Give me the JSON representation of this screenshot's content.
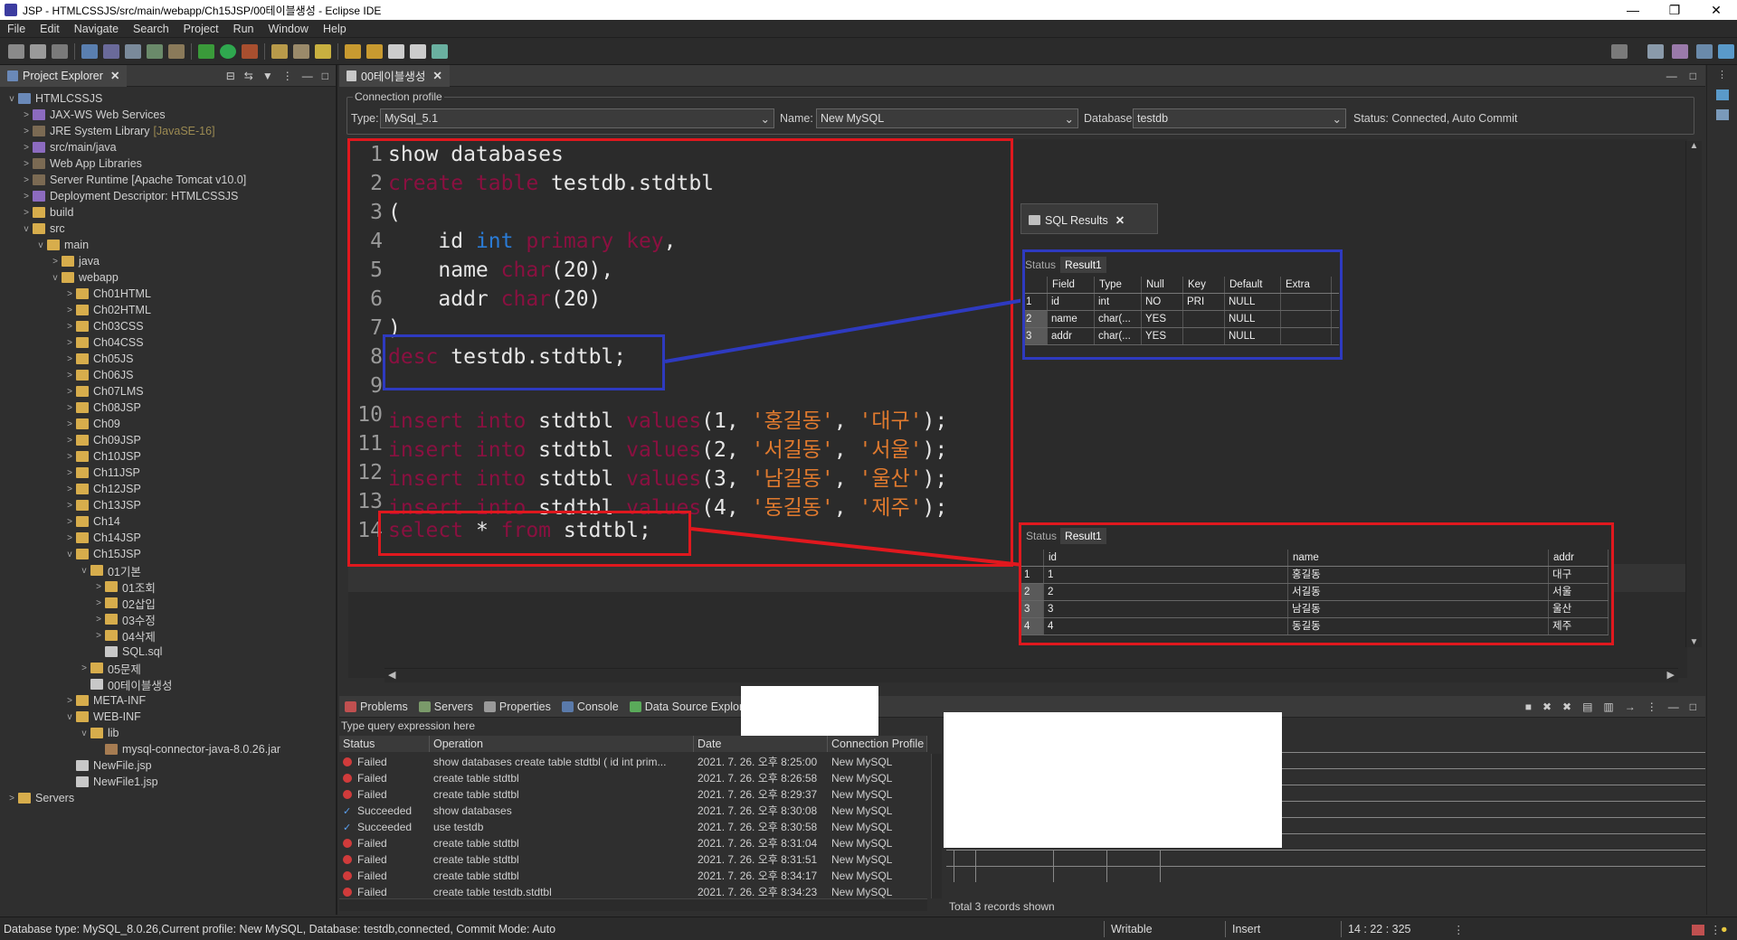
{
  "window": {
    "title": "JSP - HTMLCSSJS/src/main/webapp/Ch15JSP/00테이블생성 - Eclipse IDE",
    "min": "—",
    "max": "❐",
    "close": "✕"
  },
  "menu": [
    "File",
    "Edit",
    "Navigate",
    "Search",
    "Project",
    "Run",
    "Window",
    "Help"
  ],
  "explorer": {
    "tab_label": "Project Explorer",
    "items": [
      {
        "label": "HTMLCSSJS",
        "depth": 0,
        "twisty": "v",
        "icon": "project-icon"
      },
      {
        "label": "JAX-WS Web Services",
        "depth": 1,
        "twisty": ">",
        "icon": "service-icon"
      },
      {
        "label": "JRE System Library",
        "deco": "[JavaSE-16]",
        "depth": 1,
        "twisty": ">",
        "icon": "library-icon"
      },
      {
        "label": "src/main/java",
        "depth": 1,
        "twisty": ">",
        "icon": "source-folder-icon"
      },
      {
        "label": "Web App Libraries",
        "depth": 1,
        "twisty": ">",
        "icon": "library-icon"
      },
      {
        "label": "Server Runtime [Apache Tomcat v10.0]",
        "depth": 1,
        "twisty": ">",
        "icon": "library-icon"
      },
      {
        "label": "Deployment Descriptor: HTMLCSSJS",
        "depth": 1,
        "twisty": ">",
        "icon": "descriptor-icon"
      },
      {
        "label": "build",
        "depth": 1,
        "twisty": ">",
        "icon": "folder-icon"
      },
      {
        "label": "src",
        "depth": 1,
        "twisty": "v",
        "icon": "folder-icon"
      },
      {
        "label": "main",
        "depth": 2,
        "twisty": "v",
        "icon": "folder-icon"
      },
      {
        "label": "java",
        "depth": 3,
        "twisty": ">",
        "icon": "folder-icon"
      },
      {
        "label": "webapp",
        "depth": 3,
        "twisty": "v",
        "icon": "folder-icon"
      },
      {
        "label": "Ch01HTML",
        "depth": 4,
        "twisty": ">",
        "icon": "folder-icon"
      },
      {
        "label": "Ch02HTML",
        "depth": 4,
        "twisty": ">",
        "icon": "folder-icon"
      },
      {
        "label": "Ch03CSS",
        "depth": 4,
        "twisty": ">",
        "icon": "folder-icon"
      },
      {
        "label": "Ch04CSS",
        "depth": 4,
        "twisty": ">",
        "icon": "folder-icon"
      },
      {
        "label": "Ch05JS",
        "depth": 4,
        "twisty": ">",
        "icon": "folder-icon"
      },
      {
        "label": "Ch06JS",
        "depth": 4,
        "twisty": ">",
        "icon": "folder-icon"
      },
      {
        "label": "Ch07LMS",
        "depth": 4,
        "twisty": ">",
        "icon": "folder-icon"
      },
      {
        "label": "Ch08JSP",
        "depth": 4,
        "twisty": ">",
        "icon": "folder-icon"
      },
      {
        "label": "Ch09",
        "depth": 4,
        "twisty": ">",
        "icon": "folder-icon"
      },
      {
        "label": "Ch09JSP",
        "depth": 4,
        "twisty": ">",
        "icon": "folder-icon"
      },
      {
        "label": "Ch10JSP",
        "depth": 4,
        "twisty": ">",
        "icon": "folder-icon"
      },
      {
        "label": "Ch11JSP",
        "depth": 4,
        "twisty": ">",
        "icon": "folder-icon"
      },
      {
        "label": "Ch12JSP",
        "depth": 4,
        "twisty": ">",
        "icon": "folder-icon"
      },
      {
        "label": "Ch13JSP",
        "depth": 4,
        "twisty": ">",
        "icon": "folder-icon"
      },
      {
        "label": "Ch14",
        "depth": 4,
        "twisty": ">",
        "icon": "folder-icon"
      },
      {
        "label": "Ch14JSP",
        "depth": 4,
        "twisty": ">",
        "icon": "folder-icon"
      },
      {
        "label": "Ch15JSP",
        "depth": 4,
        "twisty": "v",
        "icon": "folder-icon"
      },
      {
        "label": "01기본",
        "depth": 5,
        "twisty": "v",
        "icon": "folder-icon"
      },
      {
        "label": "01조회",
        "depth": 6,
        "twisty": ">",
        "icon": "folder-icon"
      },
      {
        "label": "02삽입",
        "depth": 6,
        "twisty": ">",
        "icon": "folder-icon"
      },
      {
        "label": "03수정",
        "depth": 6,
        "twisty": ">",
        "icon": "folder-icon"
      },
      {
        "label": "04삭제",
        "depth": 6,
        "twisty": ">",
        "icon": "folder-icon"
      },
      {
        "label": "SQL.sql",
        "depth": 6,
        "twisty": "",
        "icon": "sql-file-icon"
      },
      {
        "label": "05문제",
        "depth": 5,
        "twisty": ">",
        "icon": "folder-icon"
      },
      {
        "label": "00테이블생성",
        "depth": 5,
        "twisty": "",
        "icon": "sql-file-icon"
      },
      {
        "label": "META-INF",
        "depth": 4,
        "twisty": ">",
        "icon": "folder-icon"
      },
      {
        "label": "WEB-INF",
        "depth": 4,
        "twisty": "v",
        "icon": "folder-icon"
      },
      {
        "label": "lib",
        "depth": 5,
        "twisty": "v",
        "icon": "folder-icon"
      },
      {
        "label": "mysql-connector-java-8.0.26.jar",
        "depth": 6,
        "twisty": "",
        "icon": "jar-icon"
      },
      {
        "label": "NewFile.jsp",
        "depth": 4,
        "twisty": "",
        "icon": "jsp-file-icon"
      },
      {
        "label": "NewFile1.jsp",
        "depth": 4,
        "twisty": "",
        "icon": "jsp-file-icon"
      },
      {
        "label": "Servers",
        "depth": 0,
        "twisty": ">",
        "icon": "folder-icon"
      }
    ]
  },
  "editor": {
    "tab_label": "00테이블생성",
    "connection": {
      "legend": "Connection profile",
      "type_label": "Type:",
      "type_value": "MySql_5.1",
      "name_label": "Name:",
      "name_value": "New MySQL",
      "db_label": "Database:",
      "db_value": "testdb",
      "status": "Status: Connected, Auto Commit"
    },
    "line_numbers": [
      "1",
      "2",
      "3",
      "4",
      "5",
      "6",
      "7",
      "8",
      "9",
      "10",
      "11",
      "12",
      "13",
      "14"
    ],
    "lines": [
      [
        {
          "t": "show databases",
          "c": "plain"
        }
      ],
      [
        {
          "t": "create table ",
          "c": "kw"
        },
        {
          "t": "testdb.stdtbl",
          "c": "plain"
        }
      ],
      [
        {
          "t": "(",
          "c": "plain"
        }
      ],
      [
        {
          "t": "    id ",
          "c": "plain"
        },
        {
          "t": "int ",
          "c": "kwb"
        },
        {
          "t": "primary key",
          "c": "kw"
        },
        {
          "t": ",",
          "c": "plain"
        }
      ],
      [
        {
          "t": "    name ",
          "c": "plain"
        },
        {
          "t": "char",
          "c": "kw"
        },
        {
          "t": "(20),",
          "c": "plain"
        }
      ],
      [
        {
          "t": "    addr ",
          "c": "plain"
        },
        {
          "t": "char",
          "c": "kw"
        },
        {
          "t": "(20)",
          "c": "plain"
        }
      ],
      [
        {
          "t": ")",
          "c": "plain"
        }
      ],
      [
        {
          "t": "desc ",
          "c": "kw"
        },
        {
          "t": "testdb.stdtbl;",
          "c": "plain"
        }
      ],
      [
        {
          "t": "",
          "c": "plain"
        }
      ],
      [
        {
          "t": "insert into ",
          "c": "kw"
        },
        {
          "t": "stdtbl ",
          "c": "plain"
        },
        {
          "t": "values",
          "c": "kw"
        },
        {
          "t": "(1, ",
          "c": "plain"
        },
        {
          "t": "'홍길동'",
          "c": "str"
        },
        {
          "t": ", ",
          "c": "plain"
        },
        {
          "t": "'대구'",
          "c": "str"
        },
        {
          "t": ");",
          "c": "plain"
        }
      ],
      [
        {
          "t": "insert into ",
          "c": "kw"
        },
        {
          "t": "stdtbl ",
          "c": "plain"
        },
        {
          "t": "values",
          "c": "kw"
        },
        {
          "t": "(2, ",
          "c": "plain"
        },
        {
          "t": "'서길동'",
          "c": "str"
        },
        {
          "t": ", ",
          "c": "plain"
        },
        {
          "t": "'서울'",
          "c": "str"
        },
        {
          "t": ");",
          "c": "plain"
        }
      ],
      [
        {
          "t": "insert into ",
          "c": "kw"
        },
        {
          "t": "stdtbl ",
          "c": "plain"
        },
        {
          "t": "values",
          "c": "kw"
        },
        {
          "t": "(3, ",
          "c": "plain"
        },
        {
          "t": "'남길동'",
          "c": "str"
        },
        {
          "t": ", ",
          "c": "plain"
        },
        {
          "t": "'울산'",
          "c": "str"
        },
        {
          "t": ");",
          "c": "plain"
        }
      ],
      [
        {
          "t": "insert into ",
          "c": "kw"
        },
        {
          "t": "stdtbl ",
          "c": "plain"
        },
        {
          "t": "values",
          "c": "kw"
        },
        {
          "t": "(4, ",
          "c": "plain"
        },
        {
          "t": "'동길동'",
          "c": "str"
        },
        {
          "t": ", ",
          "c": "plain"
        },
        {
          "t": "'제주'",
          "c": "str"
        },
        {
          "t": ");",
          "c": "plain"
        }
      ],
      [
        {
          "t": "select ",
          "c": "kw"
        },
        {
          "t": "* ",
          "c": "plain"
        },
        {
          "t": "from ",
          "c": "kw"
        },
        {
          "t": "stdtbl;",
          "c": "plain"
        }
      ]
    ]
  },
  "sql_results_popup": {
    "tab_label": "SQL Results",
    "status_tab": "Status",
    "result_tab": "Result1",
    "columns": [
      "Field",
      "Type",
      "Null",
      "Key",
      "Default",
      "Extra"
    ],
    "rows": [
      [
        "1",
        "id",
        "int",
        "NO",
        "PRI",
        "NULL",
        ""
      ],
      [
        "2",
        "name",
        "char(...",
        "YES",
        "",
        "NULL",
        ""
      ],
      [
        "3",
        "addr",
        "char(...",
        "YES",
        "",
        "NULL",
        ""
      ]
    ]
  },
  "select_results_popup": {
    "status_tab": "Status",
    "result_tab": "Result1",
    "columns": [
      "id",
      "name",
      "addr"
    ],
    "rows": [
      [
        "1",
        "1",
        "홍길동",
        "대구"
      ],
      [
        "2",
        "2",
        "서길동",
        "서울"
      ],
      [
        "3",
        "3",
        "남길동",
        "울산"
      ],
      [
        "4",
        "4",
        "동길동",
        "제주"
      ]
    ]
  },
  "bottom": {
    "tabs": [
      "Problems",
      "Servers",
      "Properties",
      "Console",
      "Data Source Explorer"
    ],
    "query_placeholder": "Type query expression here",
    "history_columns": [
      "Status",
      "Operation",
      "Date",
      "Connection Profile"
    ],
    "history": [
      {
        "status": "Failed",
        "op": "show databases  create table stdtbl  (    id int prim...",
        "date": "2021. 7. 26. 오후 8:25:00",
        "profile": "New MySQL"
      },
      {
        "status": "Failed",
        "op": "create table stdtbl",
        "date": "2021. 7. 26. 오후 8:26:58",
        "profile": "New MySQL"
      },
      {
        "status": "Failed",
        "op": "create table stdtbl",
        "date": "2021. 7. 26. 오후 8:29:37",
        "profile": "New MySQL"
      },
      {
        "status": "Succeeded",
        "op": "show databases",
        "date": "2021. 7. 26. 오후 8:30:08",
        "profile": "New MySQL"
      },
      {
        "status": "Succeeded",
        "op": "use testdb",
        "date": "2021. 7. 26. 오후 8:30:58",
        "profile": "New MySQL"
      },
      {
        "status": "Failed",
        "op": "create table stdtbl",
        "date": "2021. 7. 26. 오후 8:31:04",
        "profile": "New MySQL"
      },
      {
        "status": "Failed",
        "op": "create table stdtbl",
        "date": "2021. 7. 26. 오후 8:31:51",
        "profile": "New MySQL"
      },
      {
        "status": "Failed",
        "op": "create table stdtbl",
        "date": "2021. 7. 26. 오후 8:34:17",
        "profile": "New MySQL"
      },
      {
        "status": "Failed",
        "op": "create table testdb.stdtbl",
        "date": "2021. 7. 26. 오후 8:34:23",
        "profile": "New MySQL"
      }
    ],
    "records_shown": "Total 3 records shown"
  },
  "statusbar": {
    "info": "Database type: MySQL_8.0.26,Current profile: New MySQL, Database: testdb,connected, Commit Mode: Auto",
    "writable": "Writable",
    "insert": "Insert",
    "position": "14 : 22 : 325"
  }
}
